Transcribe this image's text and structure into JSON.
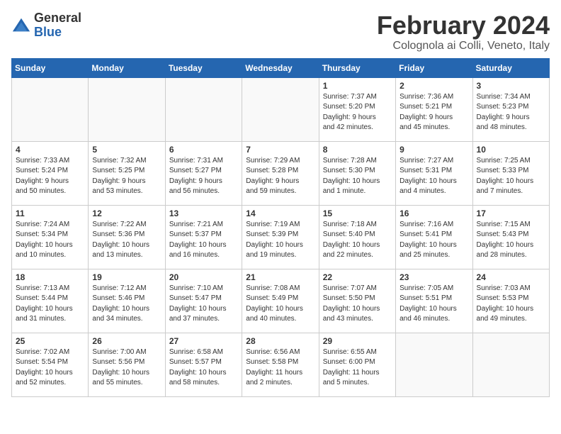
{
  "logo": {
    "general": "General",
    "blue": "Blue"
  },
  "title": {
    "month": "February 2024",
    "location": "Colognola ai Colli, Veneto, Italy"
  },
  "days_of_week": [
    "Sunday",
    "Monday",
    "Tuesday",
    "Wednesday",
    "Thursday",
    "Friday",
    "Saturday"
  ],
  "weeks": [
    [
      {
        "day": "",
        "info": ""
      },
      {
        "day": "",
        "info": ""
      },
      {
        "day": "",
        "info": ""
      },
      {
        "day": "",
        "info": ""
      },
      {
        "day": "1",
        "info": "Sunrise: 7:37 AM\nSunset: 5:20 PM\nDaylight: 9 hours\nand 42 minutes."
      },
      {
        "day": "2",
        "info": "Sunrise: 7:36 AM\nSunset: 5:21 PM\nDaylight: 9 hours\nand 45 minutes."
      },
      {
        "day": "3",
        "info": "Sunrise: 7:34 AM\nSunset: 5:23 PM\nDaylight: 9 hours\nand 48 minutes."
      }
    ],
    [
      {
        "day": "4",
        "info": "Sunrise: 7:33 AM\nSunset: 5:24 PM\nDaylight: 9 hours\nand 50 minutes."
      },
      {
        "day": "5",
        "info": "Sunrise: 7:32 AM\nSunset: 5:25 PM\nDaylight: 9 hours\nand 53 minutes."
      },
      {
        "day": "6",
        "info": "Sunrise: 7:31 AM\nSunset: 5:27 PM\nDaylight: 9 hours\nand 56 minutes."
      },
      {
        "day": "7",
        "info": "Sunrise: 7:29 AM\nSunset: 5:28 PM\nDaylight: 9 hours\nand 59 minutes."
      },
      {
        "day": "8",
        "info": "Sunrise: 7:28 AM\nSunset: 5:30 PM\nDaylight: 10 hours\nand 1 minute."
      },
      {
        "day": "9",
        "info": "Sunrise: 7:27 AM\nSunset: 5:31 PM\nDaylight: 10 hours\nand 4 minutes."
      },
      {
        "day": "10",
        "info": "Sunrise: 7:25 AM\nSunset: 5:33 PM\nDaylight: 10 hours\nand 7 minutes."
      }
    ],
    [
      {
        "day": "11",
        "info": "Sunrise: 7:24 AM\nSunset: 5:34 PM\nDaylight: 10 hours\nand 10 minutes."
      },
      {
        "day": "12",
        "info": "Sunrise: 7:22 AM\nSunset: 5:36 PM\nDaylight: 10 hours\nand 13 minutes."
      },
      {
        "day": "13",
        "info": "Sunrise: 7:21 AM\nSunset: 5:37 PM\nDaylight: 10 hours\nand 16 minutes."
      },
      {
        "day": "14",
        "info": "Sunrise: 7:19 AM\nSunset: 5:39 PM\nDaylight: 10 hours\nand 19 minutes."
      },
      {
        "day": "15",
        "info": "Sunrise: 7:18 AM\nSunset: 5:40 PM\nDaylight: 10 hours\nand 22 minutes."
      },
      {
        "day": "16",
        "info": "Sunrise: 7:16 AM\nSunset: 5:41 PM\nDaylight: 10 hours\nand 25 minutes."
      },
      {
        "day": "17",
        "info": "Sunrise: 7:15 AM\nSunset: 5:43 PM\nDaylight: 10 hours\nand 28 minutes."
      }
    ],
    [
      {
        "day": "18",
        "info": "Sunrise: 7:13 AM\nSunset: 5:44 PM\nDaylight: 10 hours\nand 31 minutes."
      },
      {
        "day": "19",
        "info": "Sunrise: 7:12 AM\nSunset: 5:46 PM\nDaylight: 10 hours\nand 34 minutes."
      },
      {
        "day": "20",
        "info": "Sunrise: 7:10 AM\nSunset: 5:47 PM\nDaylight: 10 hours\nand 37 minutes."
      },
      {
        "day": "21",
        "info": "Sunrise: 7:08 AM\nSunset: 5:49 PM\nDaylight: 10 hours\nand 40 minutes."
      },
      {
        "day": "22",
        "info": "Sunrise: 7:07 AM\nSunset: 5:50 PM\nDaylight: 10 hours\nand 43 minutes."
      },
      {
        "day": "23",
        "info": "Sunrise: 7:05 AM\nSunset: 5:51 PM\nDaylight: 10 hours\nand 46 minutes."
      },
      {
        "day": "24",
        "info": "Sunrise: 7:03 AM\nSunset: 5:53 PM\nDaylight: 10 hours\nand 49 minutes."
      }
    ],
    [
      {
        "day": "25",
        "info": "Sunrise: 7:02 AM\nSunset: 5:54 PM\nDaylight: 10 hours\nand 52 minutes."
      },
      {
        "day": "26",
        "info": "Sunrise: 7:00 AM\nSunset: 5:56 PM\nDaylight: 10 hours\nand 55 minutes."
      },
      {
        "day": "27",
        "info": "Sunrise: 6:58 AM\nSunset: 5:57 PM\nDaylight: 10 hours\nand 58 minutes."
      },
      {
        "day": "28",
        "info": "Sunrise: 6:56 AM\nSunset: 5:58 PM\nDaylight: 11 hours\nand 2 minutes."
      },
      {
        "day": "29",
        "info": "Sunrise: 6:55 AM\nSunset: 6:00 PM\nDaylight: 11 hours\nand 5 minutes."
      },
      {
        "day": "",
        "info": ""
      },
      {
        "day": "",
        "info": ""
      }
    ]
  ]
}
